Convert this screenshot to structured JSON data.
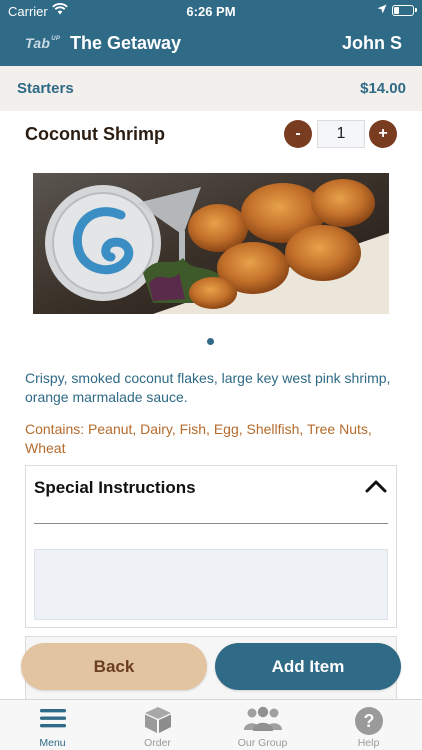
{
  "status_bar": {
    "carrier": "Carrier",
    "time": "6:26 PM",
    "battery_level": 0.3
  },
  "nav": {
    "logo_text": "Tab",
    "logo_sup": "UP",
    "title": "The Getaway",
    "user": "John S"
  },
  "category": {
    "name": "Starters",
    "price": "$14.00"
  },
  "item": {
    "name": "Coconut Shrimp",
    "quantity": "1",
    "minus_label": "-",
    "plus_label": "+",
    "description": "Crispy, smoked coconut flakes, large key west pink shrimp, orange marmalade sauce.",
    "allergens": "Contains: Peanut, Dairy, Fish, Egg, Shellfish, Tree Nuts, Wheat",
    "image_icon": "coconut-shrimp-photo",
    "carousel_pages": 1,
    "carousel_active": 0
  },
  "special_instructions": {
    "heading": "Special Instructions",
    "value": "",
    "expanded": true
  },
  "actions": {
    "back_label": "Back",
    "add_label": "Add Item"
  },
  "tab_bar": {
    "active_color": "#2f6a86",
    "inactive_color": "#9a9a9a",
    "tabs": [
      {
        "label": "Menu",
        "icon": "menu-icon",
        "active": true
      },
      {
        "label": "Order",
        "icon": "box-icon",
        "active": false
      },
      {
        "label": "Our Group",
        "icon": "group-icon",
        "active": false
      },
      {
        "label": "Help",
        "icon": "help-icon",
        "active": false
      }
    ]
  },
  "colors": {
    "brand_blue": "#2f6a86",
    "brand_brown": "#7a3c20",
    "back_button": "#e3c4a0",
    "allergen_text": "#b56b2c"
  }
}
